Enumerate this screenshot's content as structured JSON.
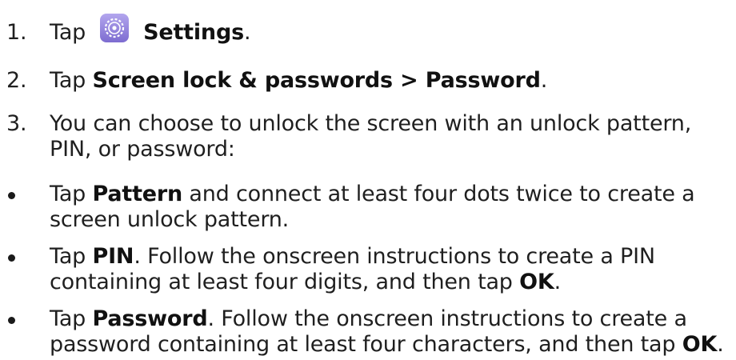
{
  "steps": [
    {
      "marker": "1.",
      "prefix": "Tap",
      "icon": "settings-icon",
      "bold": "Settings",
      "suffix": "."
    },
    {
      "marker": "2.",
      "prefix": "Tap ",
      "bold": "Screen lock & passwords > Password",
      "suffix": "."
    },
    {
      "marker": "3.",
      "line1": "You can choose to unlock the screen with an unlock pattern,",
      "line2": "PIN, or password:"
    }
  ],
  "bullets": [
    {
      "prefix": "Tap ",
      "bold": "Pattern",
      "line1_rest": " and connect at least four dots twice to create a",
      "line2": "screen unlock pattern."
    },
    {
      "prefix": "Tap ",
      "bold": "PIN",
      "line1_rest": ". Follow the onscreen instructions to create a PIN",
      "line2_text": "containing at least four digits, and then tap ",
      "line2_bold": "OK",
      "line2_end": "."
    },
    {
      "prefix": "Tap ",
      "bold": "Password",
      "line1_rest": ". Follow the onscreen instructions to create a",
      "line2_text": "password containing at least four characters, and then tap ",
      "line2_bold": "OK",
      "line2_end": "."
    }
  ],
  "colors": {
    "text": "#1f1f1f",
    "icon_bg": "#8e7fd8"
  }
}
